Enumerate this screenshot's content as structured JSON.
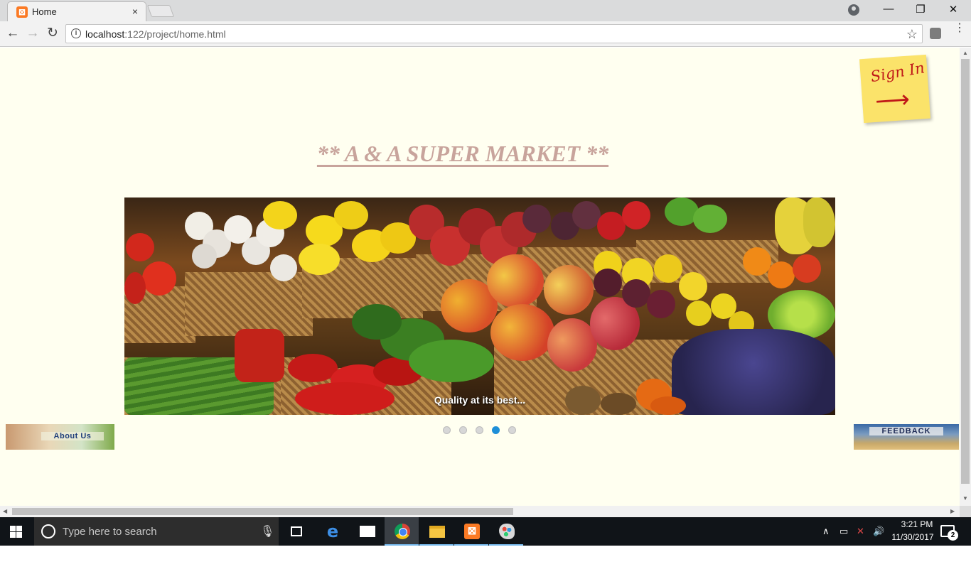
{
  "browser": {
    "tab_title": "Home",
    "tab_close": "×",
    "url_host": "localhost",
    "url_path": ":122/project/home.html",
    "window_controls": {
      "minimize": "—",
      "restore": "❐",
      "close": "✕"
    }
  },
  "page": {
    "background": "#fffff0",
    "sign_in_label": "Sign In",
    "sign_in_arrow": "⟶",
    "title": "** A & A SUPER MARKET **",
    "title_color": "#c8a49c",
    "slider": {
      "caption": "Quality at its best...",
      "slide_count": 5,
      "active_slide": 4
    },
    "about_label": "About Us",
    "feedback_label": "FEEDBACK"
  },
  "taskbar": {
    "search_placeholder": "Type here to search",
    "apps": [
      "task-view",
      "edge",
      "mail",
      "chrome",
      "file-explorer",
      "xampp",
      "paint"
    ],
    "clock_time": "3:21 PM",
    "clock_date": "11/30/2017",
    "notification_count": "2"
  }
}
